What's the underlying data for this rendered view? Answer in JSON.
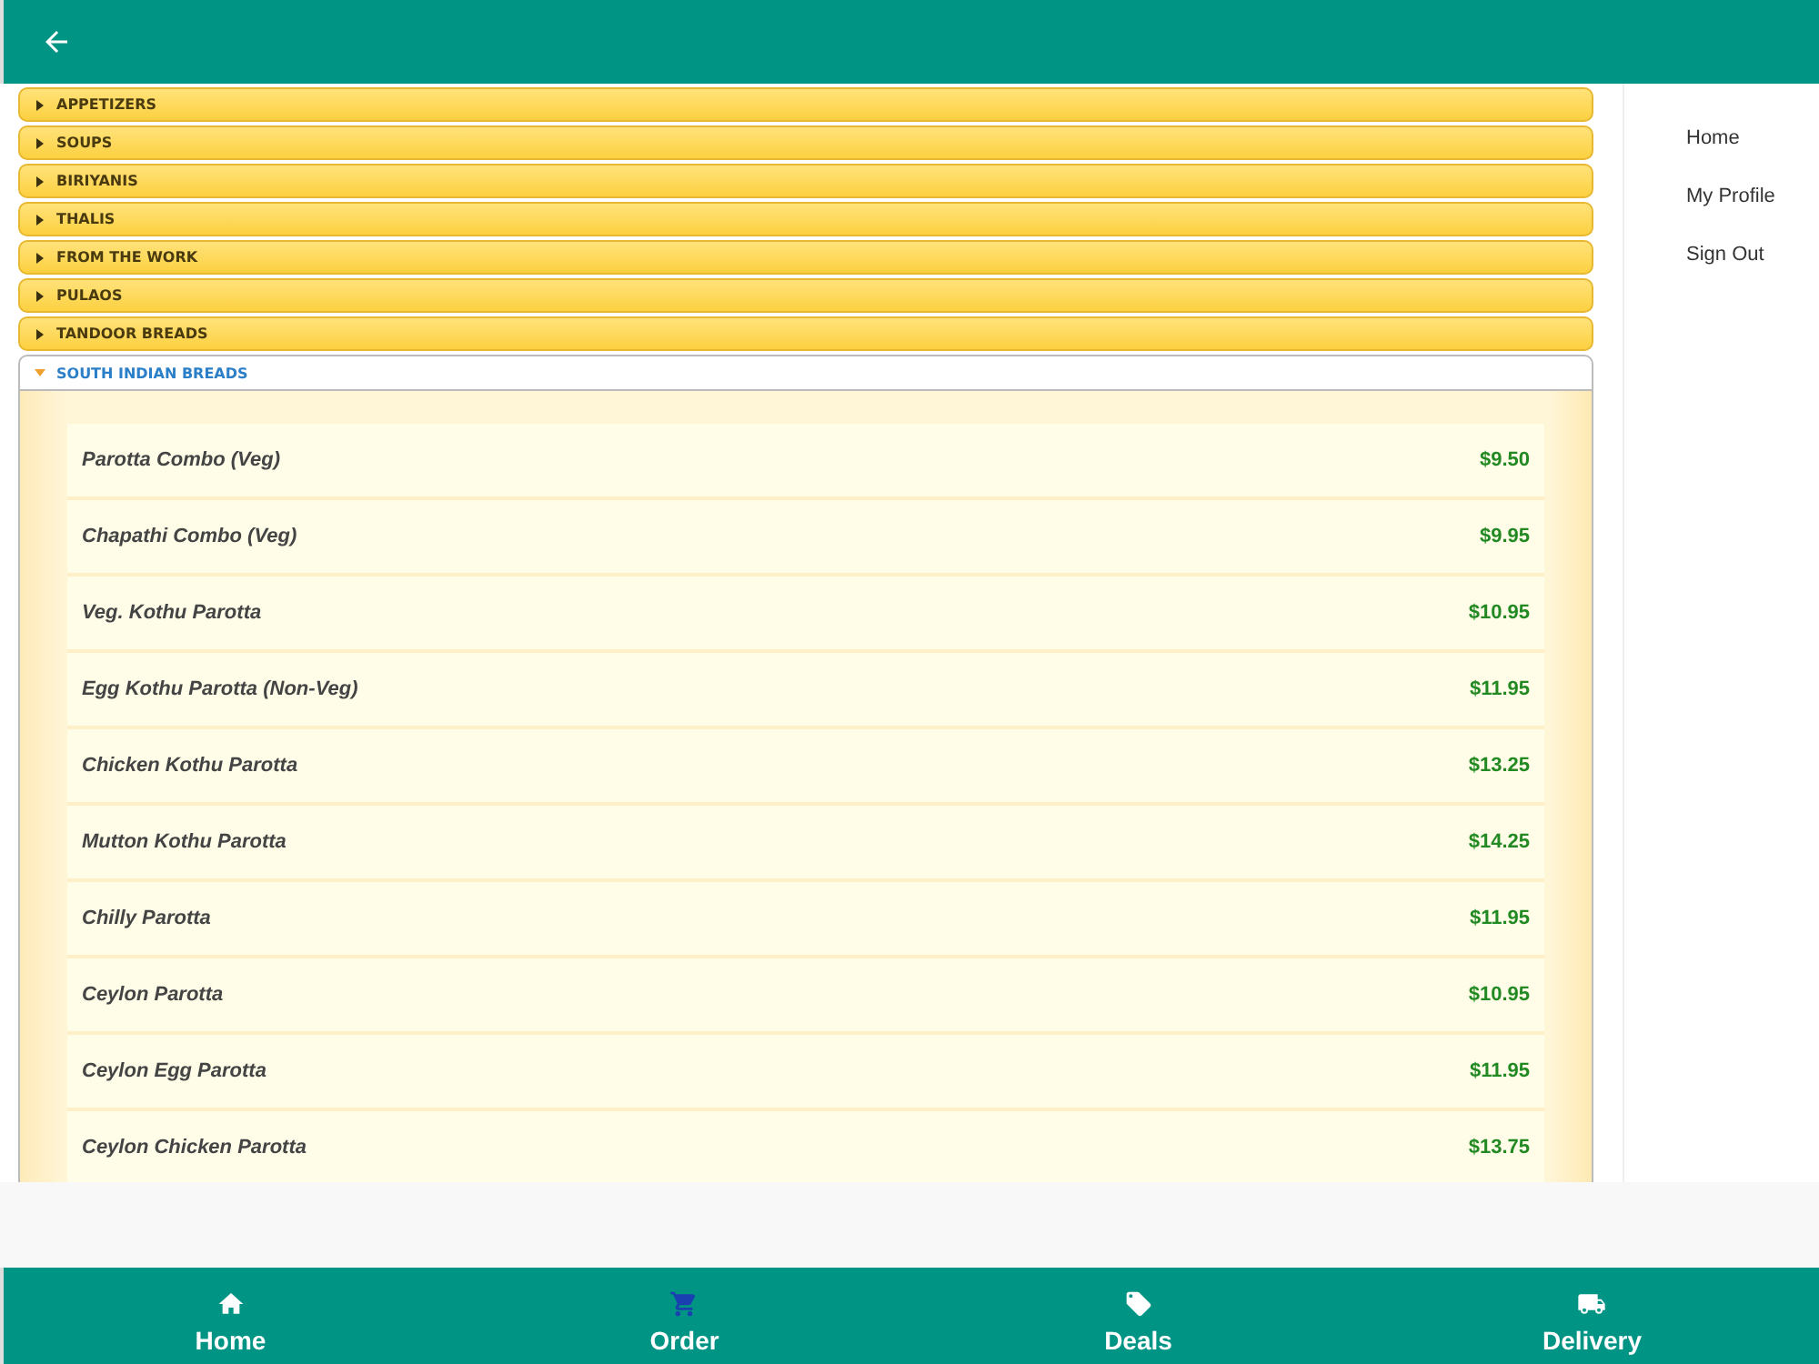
{
  "categories": [
    {
      "label": "APPETIZERS",
      "expanded": false
    },
    {
      "label": "SOUPS",
      "expanded": false
    },
    {
      "label": "BIRIYANIS",
      "expanded": false
    },
    {
      "label": "THALIS",
      "expanded": false
    },
    {
      "label": "FROM THE WORK",
      "expanded": false
    },
    {
      "label": "PULAOS",
      "expanded": false
    },
    {
      "label": "TANDOOR BREADS",
      "expanded": false
    },
    {
      "label": "SOUTH INDIAN BREADS",
      "expanded": true,
      "items": [
        {
          "name": "Parotta Combo (Veg)",
          "price": "$9.50"
        },
        {
          "name": "Chapathi Combo (Veg)",
          "price": "$9.95"
        },
        {
          "name": "Veg. Kothu Parotta",
          "price": "$10.95"
        },
        {
          "name": "Egg Kothu Parotta (Non-Veg)",
          "price": "$11.95"
        },
        {
          "name": "Chicken Kothu Parotta",
          "price": "$13.25"
        },
        {
          "name": "Mutton Kothu Parotta",
          "price": "$14.25"
        },
        {
          "name": "Chilly Parotta",
          "price": "$11.95"
        },
        {
          "name": "Ceylon Parotta",
          "price": "$10.95"
        },
        {
          "name": "Ceylon Egg Parotta",
          "price": "$11.95"
        },
        {
          "name": "Ceylon Chicken Parotta",
          "price": "$13.75"
        }
      ]
    }
  ],
  "sidebar": {
    "items": [
      "Home",
      "My Profile",
      "Sign Out"
    ]
  },
  "bottom_nav": [
    {
      "label": "Home",
      "selected": false
    },
    {
      "label": "Order",
      "selected": true
    },
    {
      "label": "Deals",
      "selected": false
    },
    {
      "label": "Delivery",
      "selected": false
    }
  ]
}
